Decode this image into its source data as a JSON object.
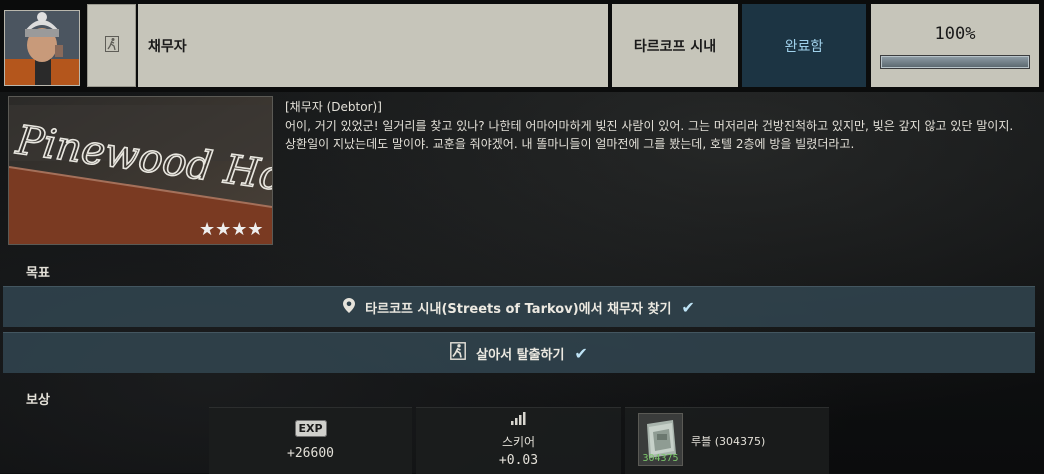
{
  "header": {
    "title": "채무자",
    "location": "타르코프 시내",
    "status": "완료함",
    "progress_text": "100%",
    "progress_fraction": 1.0
  },
  "description": {
    "heading": "[채무자 (Debtor)]",
    "body": "어이, 거기 있었군! 일거리를 찾고 있나? 나한테 어마어마하게 빚진 사람이 있어. 그는 머저리라 건방진척하고 있지만, 빚은 갚지 않고 있단 말이지. 상환일이 지났는데도 말이야. 교훈을 줘야겠어. 내 똘마니들이 얼마전에 그를 봤는데, 호텔 2층에 방을 빌렸더라고.",
    "image_sign_text": "Pinewood Hotel"
  },
  "objectives": {
    "label": "목표",
    "items": [
      {
        "text": "타르코프 시내(Streets of Tarkov)에서 채무자 찾기",
        "icon": "location-pin-icon"
      },
      {
        "text": "살아서 탈출하기",
        "icon": "running-exit-icon"
      }
    ]
  },
  "rewards": {
    "label": "보상",
    "exp": {
      "badge": "EXP",
      "value": "+26600"
    },
    "skill": {
      "name": "스키어",
      "value": "+0.03",
      "icon": "rank-bars-icon"
    },
    "item": {
      "name": "루블  (304375)",
      "count": "304375",
      "icon": "rouble-stack-icon"
    }
  },
  "colors": {
    "status_bg": "#1c3443",
    "status_text": "#9fd0ea",
    "objective_bg": "#30424c",
    "check": "#bfe4f6",
    "header_box": "#c6c5ba"
  }
}
